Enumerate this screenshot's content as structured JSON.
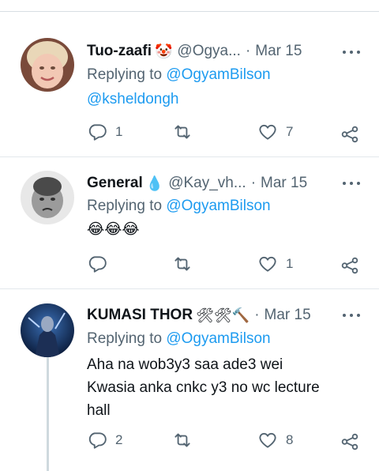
{
  "tweets": [
    {
      "name": "Tuo-zaafi",
      "name_emoji": "🤡",
      "handle": "@Ogya...",
      "separator": "·",
      "date": "Mar 15",
      "replying_prefix": "Replying to",
      "replying_to": "@OgyamBilson",
      "body": "@ksheldongh",
      "body_is_mention": true,
      "stats": {
        "replies": "1",
        "retweets": "",
        "likes": "7"
      }
    },
    {
      "name": "General",
      "name_emoji": "💧",
      "handle": "@Kay_vh...",
      "separator": "·",
      "date": "Mar 15",
      "replying_prefix": "Replying to",
      "replying_to": "@OgyamBilson",
      "body": "😂😂😂",
      "body_is_mention": false,
      "stats": {
        "replies": "",
        "retweets": "",
        "likes": "1"
      }
    },
    {
      "name": "KUMASI THOR",
      "name_emoji": "🛠🛠🔨",
      "handle": "",
      "separator": "·",
      "date": "Mar 15",
      "replying_prefix": "Replying to",
      "replying_to": "@OgyamBilson",
      "body_lines": [
        "Aha na wob3y3 saa ade3 wei",
        "Kwasia anka cnkc y3 no wc lecture",
        "hall"
      ],
      "body_is_mention": false,
      "stats": {
        "replies": "2",
        "retweets": "",
        "likes": "8"
      }
    }
  ],
  "icons": {
    "reply": "reply-icon",
    "retweet": "retweet-icon",
    "like": "heart-icon",
    "share": "share-icon",
    "more": "more-options-icon"
  },
  "colors": {
    "link": "#1d9bf0",
    "secondary_text": "#536471",
    "primary_text": "#0f1419",
    "divider": "#e3e8ec"
  }
}
